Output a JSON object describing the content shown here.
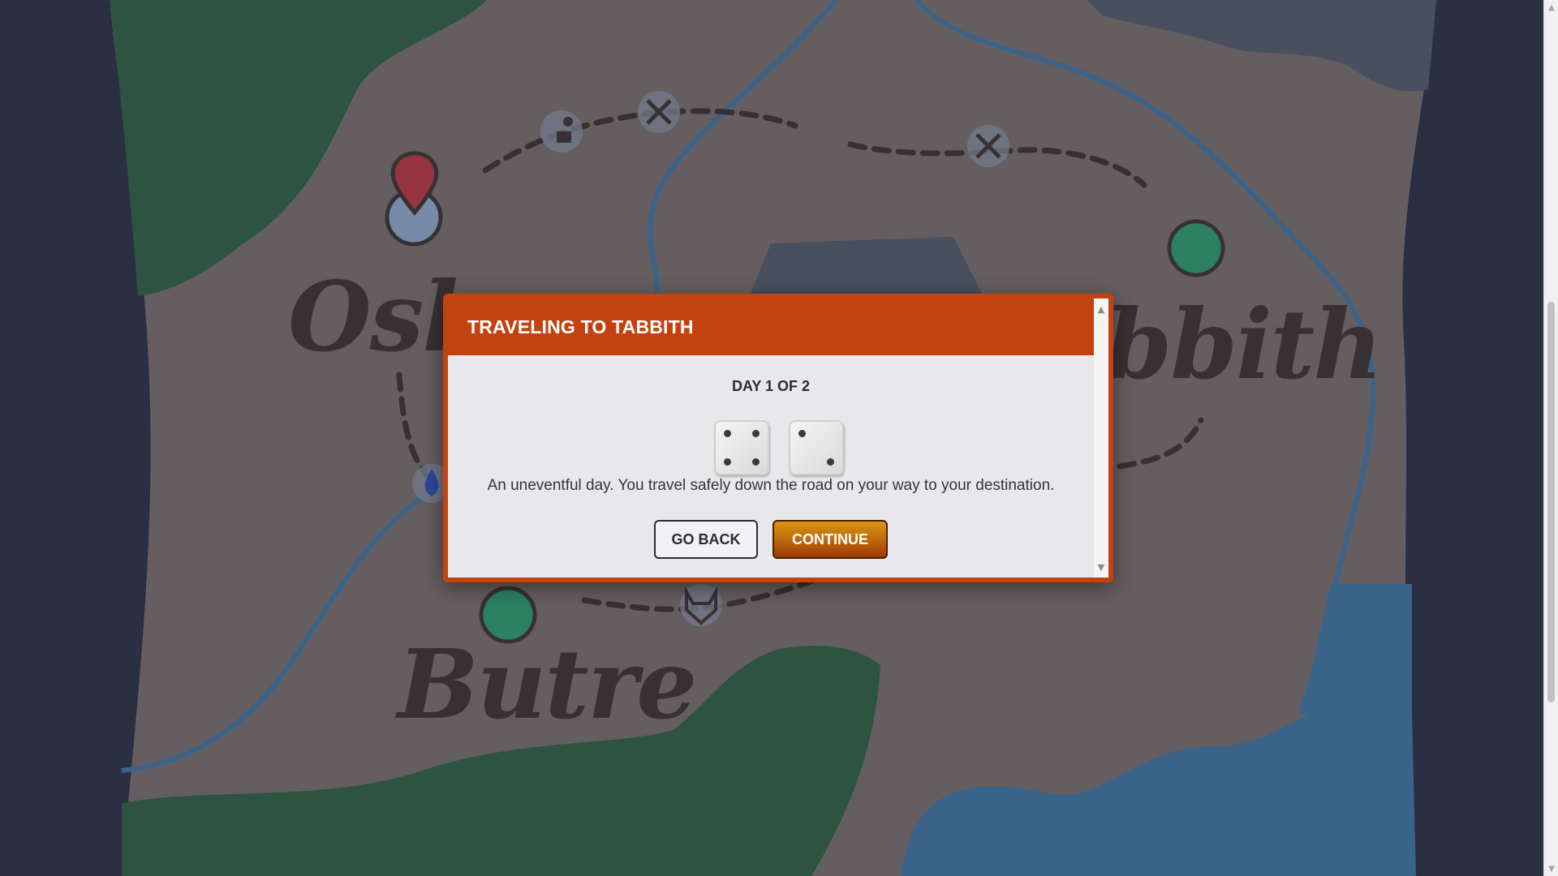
{
  "map": {
    "towns": [
      {
        "id": "oskel",
        "label": "Osk"
      },
      {
        "id": "tabbith",
        "label": "bbith"
      },
      {
        "id": "butre",
        "label": "Butre"
      }
    ]
  },
  "dialog": {
    "title": "TRAVELING TO TABBITH",
    "day_label": "DAY 1 OF 2",
    "dice": [
      4,
      2
    ],
    "message": "An uneventful day. You travel safely down the road on your way to your destination.",
    "go_back_label": "GO BACK",
    "continue_label": "CONTINUE"
  },
  "icons": {
    "scroll_up": "▲",
    "scroll_down": "▼"
  },
  "colors": {
    "accent": "#c4420f",
    "continue_button": "#c06a0a",
    "forest": "#2f5a45",
    "water": "#3e6a93",
    "mountain": "#4d5465",
    "land": "#6c6468"
  }
}
